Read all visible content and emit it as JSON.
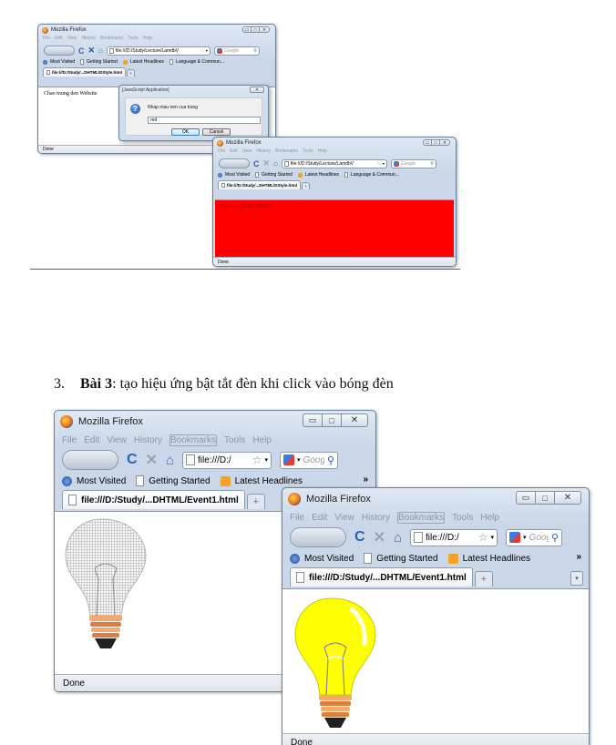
{
  "figure1": {
    "win1": {
      "title": "Mozilla Firefox",
      "menu": [
        "File",
        "Edit",
        "View",
        "History",
        "Bookmarks",
        "Tools",
        "Help"
      ],
      "url": "file:///D:/Study/Lecture/LamdbV",
      "search_placeholder": "Google",
      "bookmarks": [
        "Most Visited",
        "Getting Started",
        "Latest Headlines",
        "Language & Commun..."
      ],
      "tab": "file:///D:/Study/...DHTML/DStyle.html",
      "content_text": "Chao mung den Website",
      "status": "Done"
    },
    "dialog": {
      "title": "[JavaScript Application]",
      "prompt": "Nhap mau nen cua trang",
      "input_value": "red",
      "ok": "OK",
      "cancel": "Cancel"
    },
    "win2": {
      "title": "Mozilla Firefox",
      "menu": [
        "File",
        "Edit",
        "View",
        "History",
        "Bookmarks",
        "Tools",
        "Help"
      ],
      "url": "file:///D:/Study/Lecture/LamdbV",
      "search_placeholder": "Google",
      "bookmarks": [
        "Most Visited",
        "Getting Started",
        "Latest Headlines",
        "Language & Commun..."
      ],
      "tab": "file:///D:/Study/...DHTML/DStyle.html",
      "content_text": "Chao mung den Website",
      "content_bg": "#ff0000",
      "status": "Done"
    }
  },
  "item": {
    "number": "3.",
    "bold": "Bài 3",
    "text": ": tạo hiệu ứng bật tắt đèn khi click vào bóng đèn"
  },
  "figure2": {
    "win1": {
      "title": "Mozilla Firefox",
      "menu": [
        "File",
        "Edit",
        "View",
        "History",
        "Bookmarks",
        "Tools",
        "Help"
      ],
      "url": "file:///D:/",
      "search_placeholder": "Goog",
      "bookmarks": [
        "Most Visited",
        "Getting Started",
        "Latest Headlines"
      ],
      "chevron": "»",
      "tab": "file:///D:/Study/...DHTML/Event1.html",
      "bulb": "off",
      "status": "Done"
    },
    "win2": {
      "title": "Mozilla Firefox",
      "menu": [
        "File",
        "Edit",
        "View",
        "History",
        "Bookmarks",
        "Tools",
        "Help"
      ],
      "url": "file:///D:/",
      "search_placeholder": "Goog",
      "bookmarks": [
        "Most Visited",
        "Getting Started",
        "Latest Headlines"
      ],
      "chevron": "»",
      "tab": "file:///D:/Study/...DHTML/Event1.html",
      "bulb": "on",
      "bulb_color": "#ffff00",
      "status": "Done"
    }
  }
}
